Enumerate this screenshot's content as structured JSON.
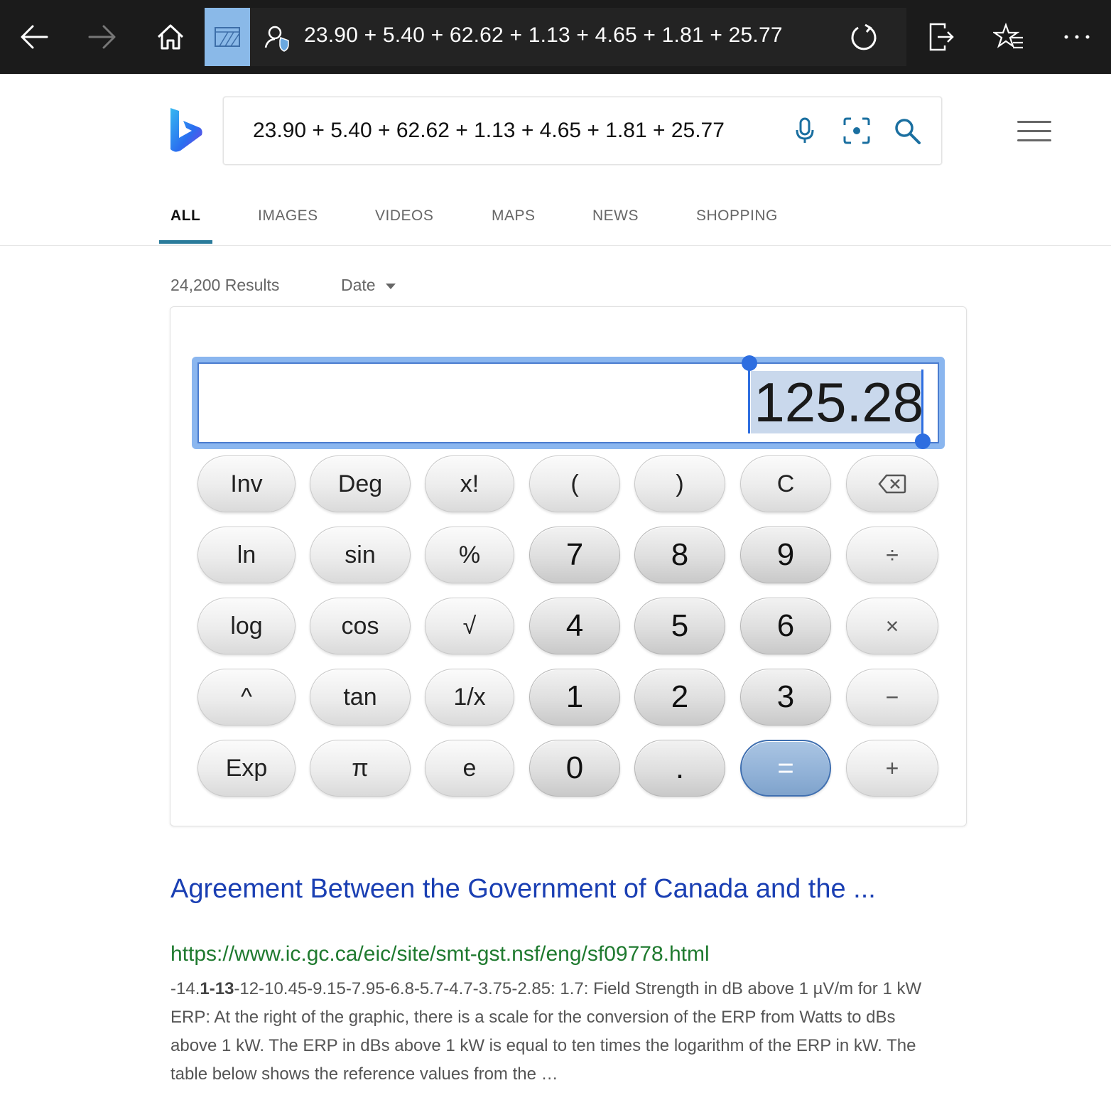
{
  "browser": {
    "address_text": "23.90 + 5.40 + 62.62 + 1.13 + 4.65 + 1.81 + 25.77",
    "icons": [
      "back-arrow-icon",
      "forward-arrow-icon",
      "home-icon",
      "tab-thumbnail-icon",
      "site-info-icon",
      "reload-icon",
      "share-icon",
      "favorites-icon",
      "more-icon"
    ]
  },
  "search": {
    "query": "23.90 + 5.40 + 62.62 + 1.13 + 4.65 + 1.81 + 25.77",
    "icons": [
      "microphone-icon",
      "visual-search-icon",
      "search-icon",
      "menu-icon"
    ]
  },
  "tabs": [
    {
      "label": "ALL",
      "active": true
    },
    {
      "label": "IMAGES"
    },
    {
      "label": "VIDEOS"
    },
    {
      "label": "MAPS"
    },
    {
      "label": "NEWS"
    },
    {
      "label": "SHOPPING"
    }
  ],
  "filters": {
    "results_count": "24,200 Results",
    "date_label": "Date"
  },
  "calculator": {
    "display_value": "125.28",
    "keys": [
      [
        "Inv",
        "Deg",
        "x!",
        "(",
        ")",
        "C",
        "⌫"
      ],
      [
        "ln",
        "sin",
        "%",
        "7",
        "8",
        "9",
        "÷"
      ],
      [
        "log",
        "cos",
        "√",
        "4",
        "5",
        "6",
        "×"
      ],
      [
        "^",
        "tan",
        "1/x",
        "1",
        "2",
        "3",
        "−"
      ],
      [
        "Exp",
        "π",
        "e",
        "0",
        ".",
        "=",
        "+"
      ]
    ]
  },
  "result": {
    "title": "Agreement Between the Government of Canada and the ...",
    "url": "https://www.ic.gc.ca/eic/site/smt-gst.nsf/eng/sf09778.html",
    "snippet_prefix": "-14.",
    "snippet_bold_1": "1",
    "snippet_dash": "-",
    "snippet_bold_2": "13",
    "snippet_rest": "-12-10.45-9.15-7.95-6.8-5.7-4.7-3.75-2.85: 1.7: Field Strength in dB above 1 µV/m for 1 kW ERP: At the right of the graphic, there is a scale for the conversion of the ERP from Watts to dBs above 1 kW. The ERP in dBs above 1 kW is equal to ten times the logarithm of the ERP in kW. The table below shows the reference values from the …"
  }
}
